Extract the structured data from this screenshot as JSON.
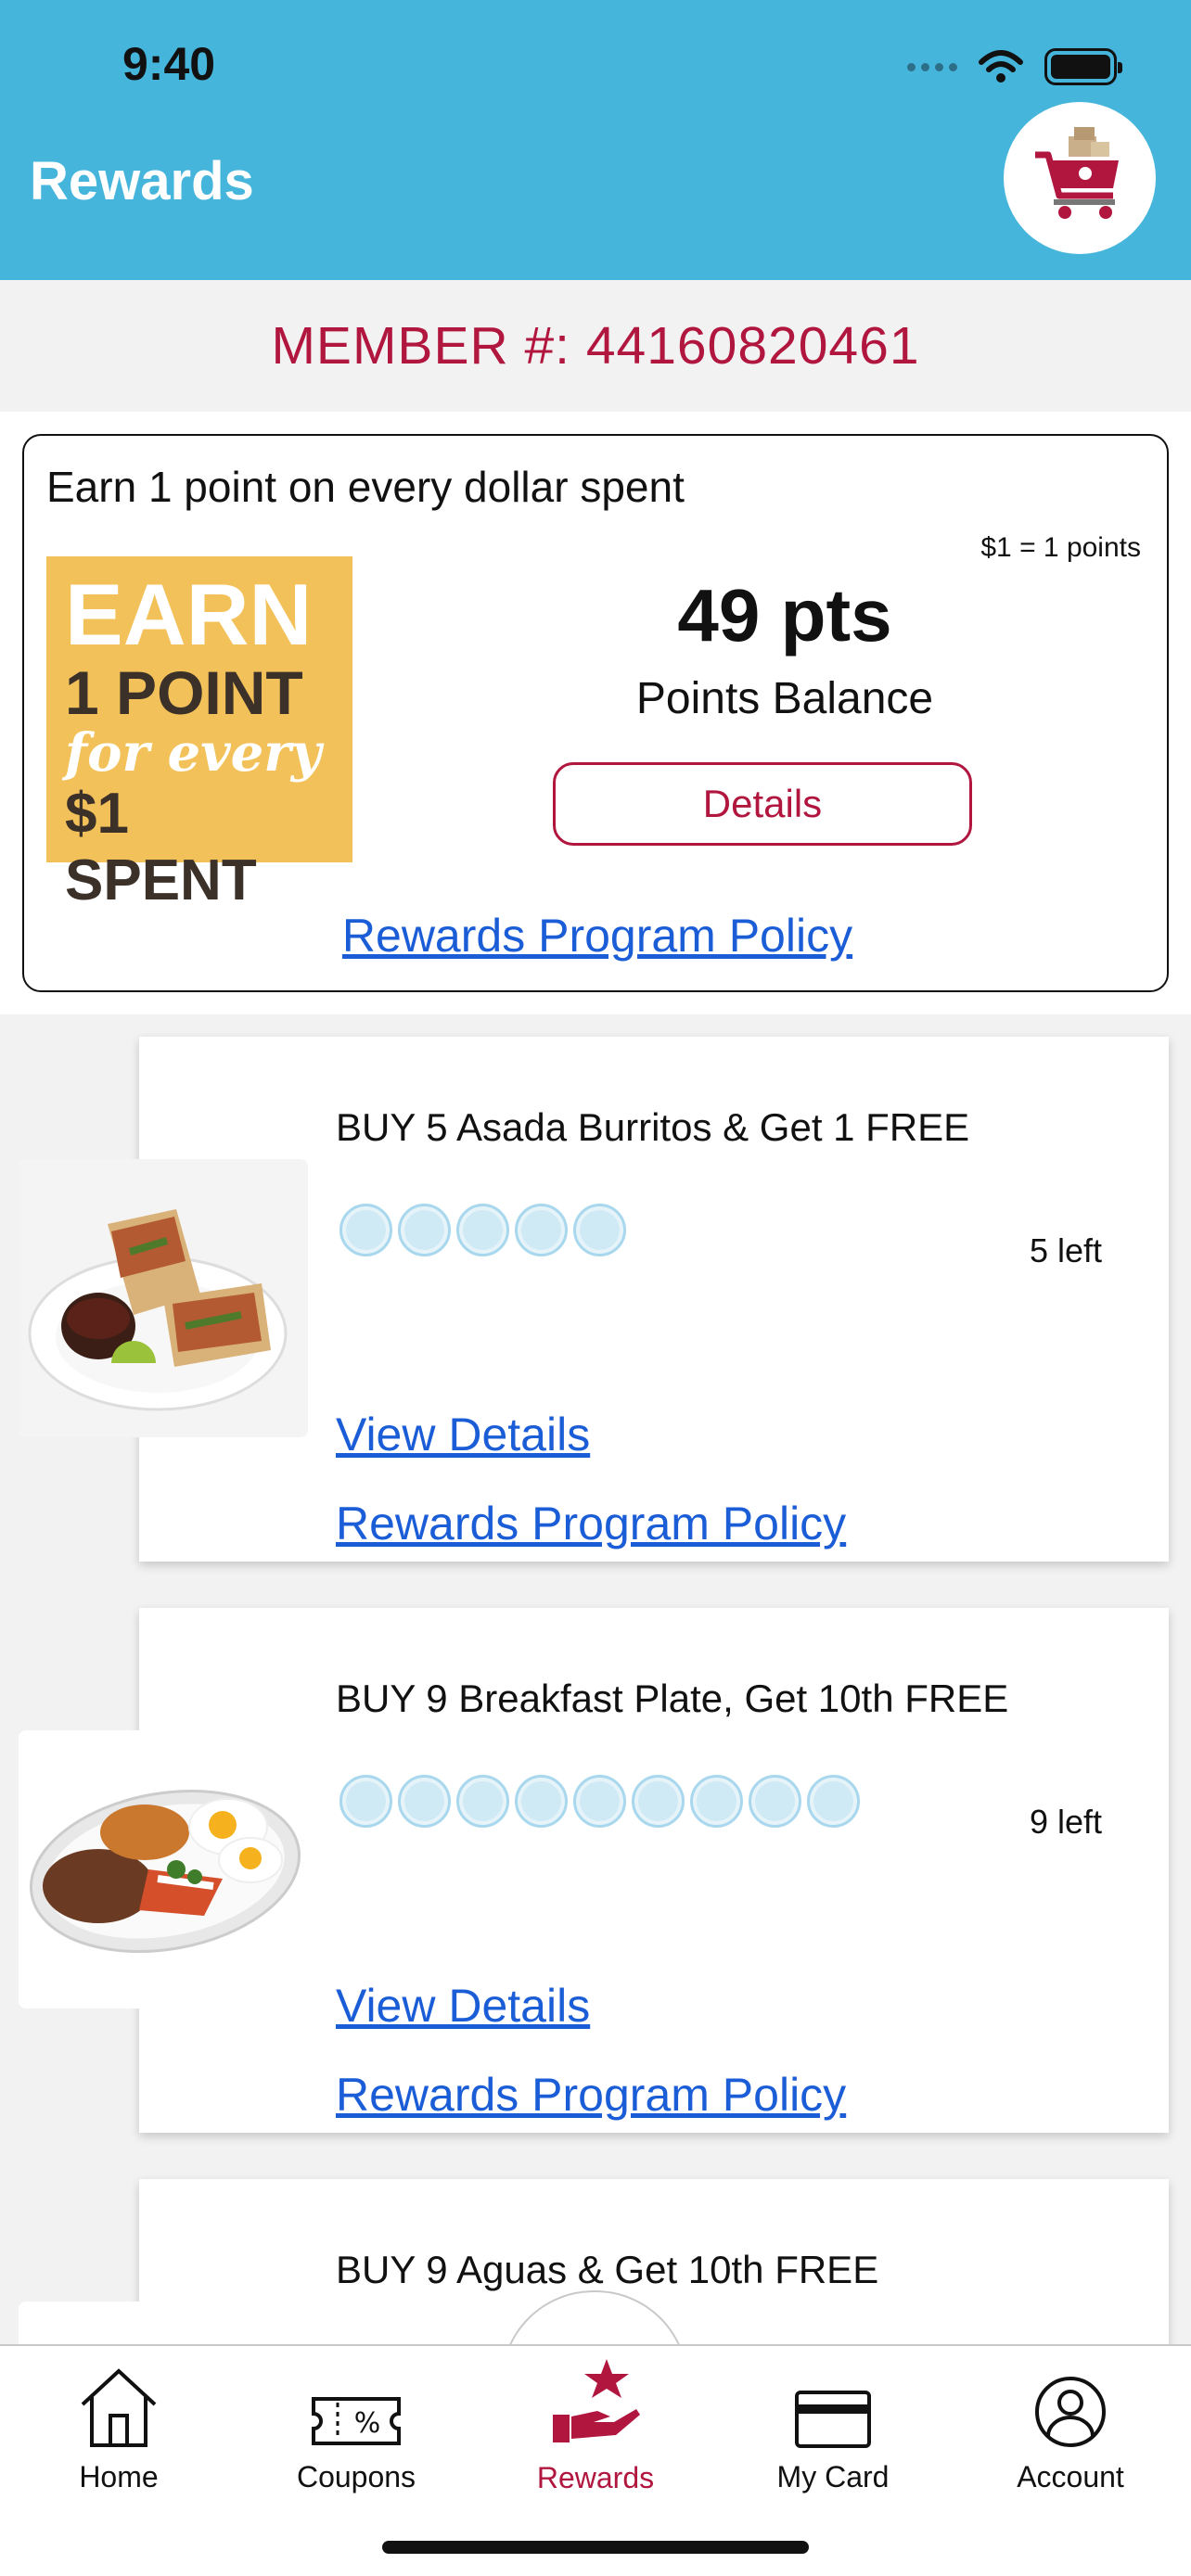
{
  "status_bar": {
    "time": "9:40"
  },
  "header": {
    "title": "Rewards",
    "cart_icon": "shopping-cart-icon"
  },
  "member": {
    "label": "MEMBER #: 44160820461"
  },
  "points_card": {
    "headline": "Earn 1 point on every dollar spent",
    "rate_note": "$1 = 1 points",
    "badge": {
      "line1": "EARN",
      "line2": "1 POINT",
      "line3": "for every",
      "line4": "$1 SPENT"
    },
    "points_value": "49 pts",
    "points_label": "Points Balance",
    "details_label": "Details",
    "policy_link": "Rewards Program Policy"
  },
  "rewards": [
    {
      "title": "BUY 5 Asada Burritos & Get 1 FREE",
      "punches_total": 5,
      "left_text": "5 left",
      "view_details": "View Details",
      "policy_link": "Rewards Program Policy",
      "image": "burrito-image"
    },
    {
      "title": "BUY 9 Breakfast Plate, Get 10th FREE",
      "punches_total": 9,
      "left_text": "9 left",
      "view_details": "View Details",
      "policy_link": "Rewards Program Policy",
      "image": "breakfast-plate-image"
    },
    {
      "title": "BUY 9 Aguas & Get 10th FREE",
      "image": "aguas-image"
    }
  ],
  "tabs": [
    {
      "label": "Home",
      "icon": "home-icon",
      "active": false
    },
    {
      "label": "Coupons",
      "icon": "coupon-icon",
      "active": false
    },
    {
      "label": "Rewards",
      "icon": "rewards-star-icon",
      "active": true
    },
    {
      "label": "My Card",
      "icon": "card-icon",
      "active": false
    },
    {
      "label": "Account",
      "icon": "account-icon",
      "active": false
    }
  ],
  "colors": {
    "header": "#46b5dc",
    "brand": "#b1163f",
    "link": "#1a5dd6",
    "badge": "#f3c15a"
  }
}
